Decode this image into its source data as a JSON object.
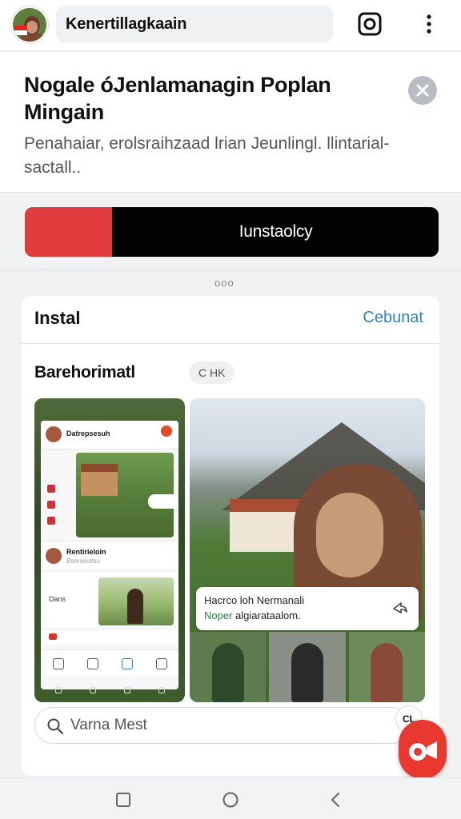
{
  "header": {
    "title": "Kenertillagkaain",
    "icons": [
      "avatar",
      "instagram-icon",
      "more-vert-icon"
    ]
  },
  "banner": {
    "title": "Nogale óJenlamanagin Poplan Mingain",
    "description": "Penahaiar, erolsraihzaad lrian Jeunlingl. llintarial-sactall..",
    "close_icon": "close-icon"
  },
  "action_bar": {
    "label": "Iunstaolcy",
    "progress_fraction": 0.21,
    "fill_color": "#e23b3b"
  },
  "card": {
    "title": "Instal",
    "link": "Cebunat",
    "section_title": "Barehorimatl",
    "chip": "C HK",
    "phone_mock": {
      "post_title": "Datrepsesuh",
      "post2_title": "Rentirieloin",
      "post2_sub": "Bsnrseuitsu",
      "card_label": "Dans"
    },
    "photo": {
      "caption_line1": "Hacrco loh Nermanali",
      "caption_line2_green": "Noper",
      "caption_line2_rest": " algiarataalom."
    },
    "search_placeholder": "Varna Mest"
  },
  "fab_small_label": "CL",
  "colors": {
    "accent_red": "#e23b3b",
    "link_blue": "#2e82c8",
    "caption_green": "#1f8a3a"
  }
}
